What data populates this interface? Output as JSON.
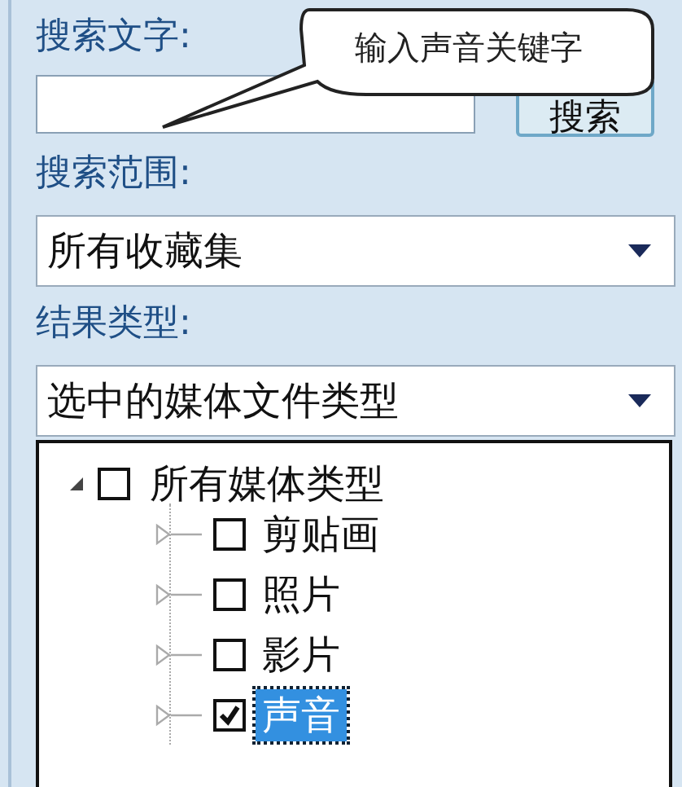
{
  "search_text": {
    "label": "搜索文字:",
    "button": "搜索"
  },
  "callout": {
    "text": "输入声音关键字"
  },
  "search_scope": {
    "label": "搜索范围:",
    "value": "所有收藏集"
  },
  "result_types": {
    "label": "结果类型:",
    "value": "选中的媒体文件类型",
    "tree": [
      {
        "label": "所有媒体类型",
        "checked": false,
        "selected": false,
        "expanded": true,
        "children": [
          {
            "label": "剪贴画",
            "checked": false,
            "selected": false,
            "expanded": false
          },
          {
            "label": "照片",
            "checked": false,
            "selected": false,
            "expanded": false
          },
          {
            "label": "影片",
            "checked": false,
            "selected": false,
            "expanded": false
          },
          {
            "label": "声音",
            "checked": true,
            "selected": true,
            "expanded": false
          }
        ]
      }
    ]
  }
}
